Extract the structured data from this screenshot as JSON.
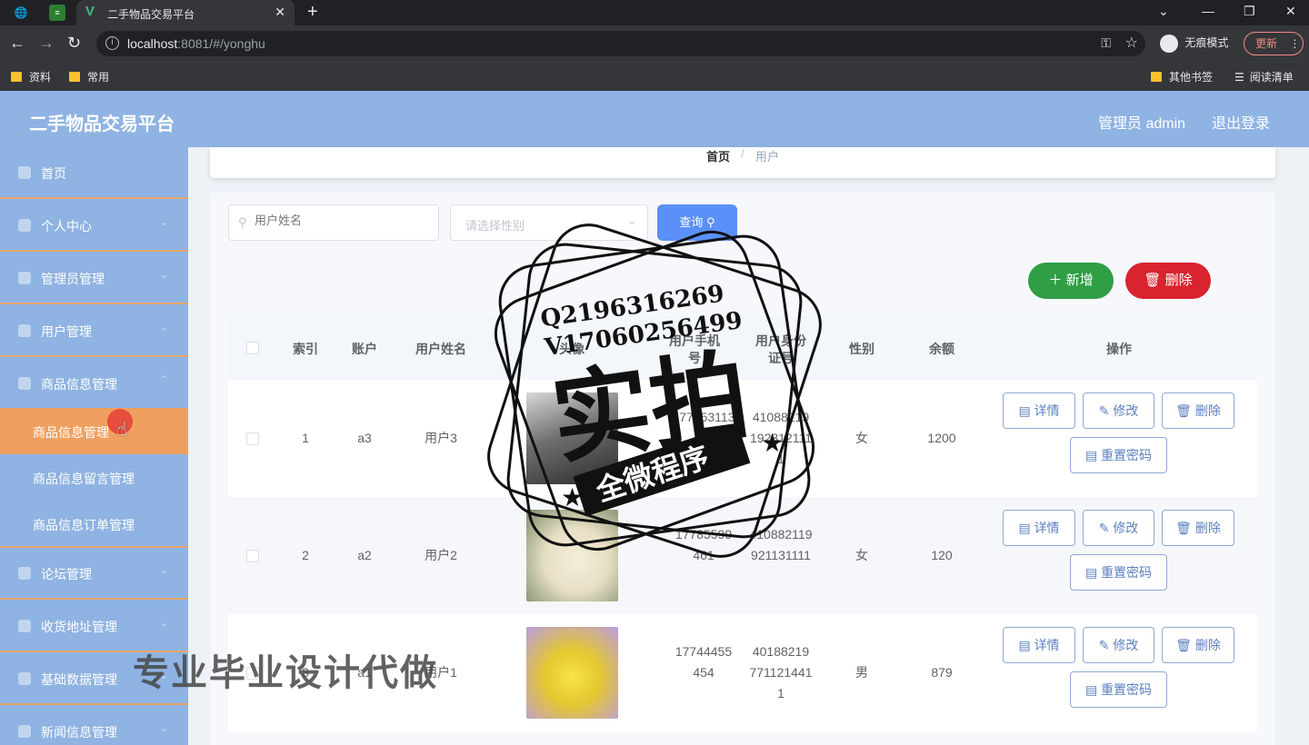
{
  "browser": {
    "tab_title": "二手物品交易平台",
    "url_host": "localhost",
    "url_rest": ":8081/#/yonghu",
    "incognito_label": "无痕模式",
    "update_label": "更新",
    "bookmarks": [
      "资料",
      "常用"
    ],
    "bookmarks_right": [
      "其他书签",
      "阅读清单"
    ]
  },
  "header": {
    "title": "二手物品交易平台",
    "admin": "管理员 admin",
    "logout": "退出登录"
  },
  "sidebar": {
    "items": [
      {
        "label": "首页",
        "icon": "home-icon"
      },
      {
        "label": "个人中心",
        "icon": "user-icon"
      },
      {
        "label": "管理员管理",
        "icon": "admin-icon"
      },
      {
        "label": "用户管理",
        "icon": "users-icon"
      },
      {
        "label": "商品信息管理",
        "icon": "goods-icon"
      },
      {
        "label": "论坛管理",
        "icon": "forum-icon"
      },
      {
        "label": "收货地址管理",
        "icon": "address-icon"
      },
      {
        "label": "基础数据管理",
        "icon": "data-icon"
      },
      {
        "label": "新闻信息管理",
        "icon": "news-icon"
      }
    ],
    "subitems": [
      "商品信息管理",
      "商品信息留言管理",
      "商品信息订单管理"
    ]
  },
  "breadcrumb": {
    "home": "首页",
    "sep": "/",
    "current": "用户"
  },
  "search": {
    "name_placeholder": "用户姓名",
    "gender_placeholder": "请选择性别",
    "query_label": "查询",
    "add_label": "新增",
    "delete_label": "删除"
  },
  "table": {
    "headers": {
      "index": "索引",
      "account": "账户",
      "name": "用户姓名",
      "avatar": "头像",
      "phone": "用户手机号",
      "idcard": "用户身份证号",
      "gender": "性别",
      "balance": "余额",
      "ops": "操作"
    },
    "rows": [
      {
        "index": "1",
        "account": "a3",
        "name": "用户3",
        "phone": "17785311331",
        "idcard": "410882191923121111",
        "gender": "女",
        "balance": "1200"
      },
      {
        "index": "2",
        "account": "a2",
        "name": "用户2",
        "phone": "17785599461",
        "idcard": "410882119921131111",
        "gender": "女",
        "balance": "120"
      },
      {
        "index": "3",
        "account": "a1",
        "name": "用户1",
        "phone": "17744455454",
        "idcard": "401882197711214411",
        "gender": "男",
        "balance": "879"
      }
    ],
    "ops": {
      "detail": "详情",
      "edit": "修改",
      "delete": "删除",
      "reset": "重置密码"
    }
  },
  "overlay": {
    "stamp_line1": "Q2196316269",
    "stamp_line2": "V17060256499",
    "stamp_big": "实拍",
    "stamp_banner": "全微程序",
    "watermark": "专业毕业设计代做"
  },
  "colors": {
    "header_bg": "#8fb3e2",
    "active_menu": "#efa060",
    "add_button": "#2f9e44",
    "delete_button": "#d9232e",
    "query_button": "#5b8ff9"
  }
}
